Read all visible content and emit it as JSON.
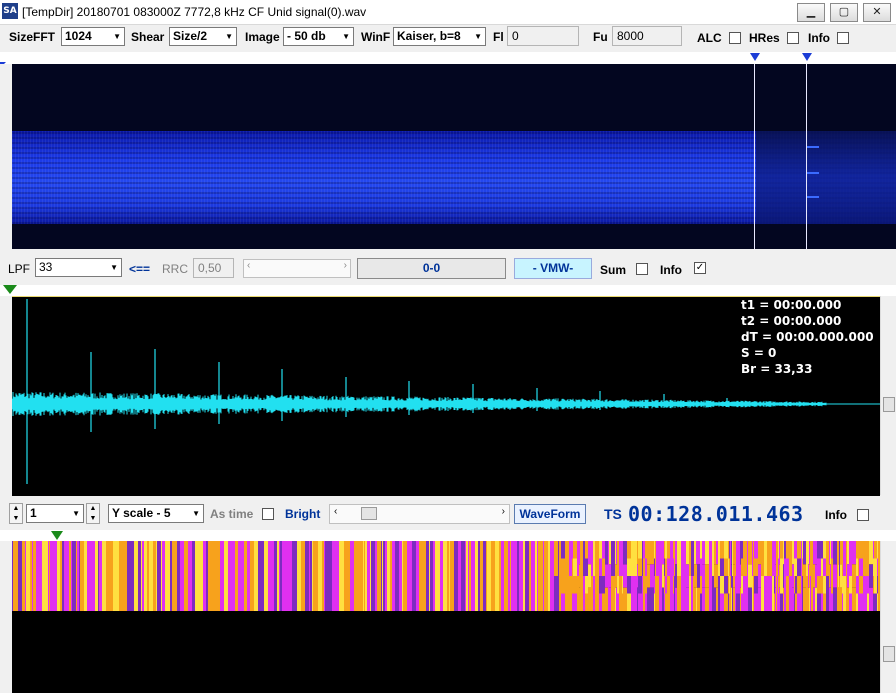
{
  "window": {
    "title": "[TempDir] 20180701 083000Z 7772,8 kHz CF Unid signal(0).wav",
    "app_icon": "SA",
    "minimize": "▁",
    "maximize": "▢",
    "close": "✕"
  },
  "toolbar1": {
    "sizefft_label": "SizeFFT",
    "sizefft_value": "1024",
    "shear_label": "Shear",
    "shear_value": "Size/2",
    "image_label": "Image",
    "image_value": "- 50 db",
    "winf_label": "WinF",
    "winf_value": "Kaiser, b=8",
    "fl_label": "Fl",
    "fl_value": "0",
    "fu_label": "Fu",
    "fu_value": "8000",
    "alc_label": "ALC",
    "hres_label": "HRes",
    "info_label": "Info"
  },
  "toolbar2": {
    "lpf_label": "LPF",
    "lpf_value": "33",
    "arrow_label": "<==",
    "rrc_label": "RRC",
    "rrc_value": "0,50",
    "range_display": "0-0",
    "vmw_button": "- VMW-",
    "sum_label": "Sum",
    "info_label": "Info"
  },
  "measurements": {
    "t1": "t1 = 00:00.000",
    "t2": "t2 = 00:00.000",
    "dt": "dT = 00:00.000.000",
    "s": "S = 0",
    "br": "Br = 33,33"
  },
  "toolbar3": {
    "spin_value": "1",
    "yscale_value": "Y scale - 5",
    "astime_label": "As time",
    "bright_label": "Bright",
    "waveform_button": "WaveForm",
    "ts_label": "TS",
    "ts_value": "00:128.011.463",
    "info_label": "Info"
  },
  "colors": {
    "spectrogram_band": "#2448f0",
    "waveform_trace": "#22e0f0",
    "phase_magenta": "#e030f0",
    "phase_orange": "#f7a21c",
    "phase_yellow": "#ffe040",
    "phase_purple": "#7d2cc0"
  },
  "checkboxes": {
    "alc": false,
    "hres": false,
    "info_top": false,
    "sum": false,
    "info_mid": true,
    "as_time": false,
    "info_bottom": false
  }
}
